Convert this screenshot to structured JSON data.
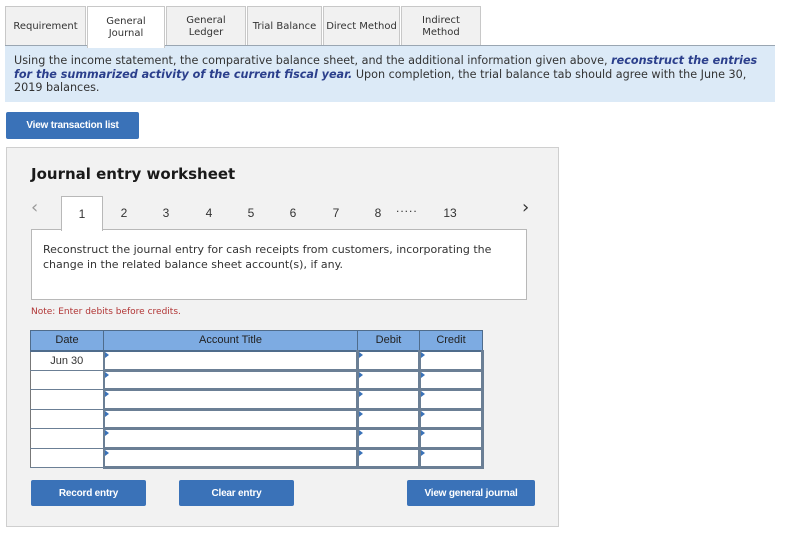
{
  "tabs": [
    {
      "label": "Requirement",
      "active": false
    },
    {
      "label": "General\nJournal",
      "active": true
    },
    {
      "label": "General\nLedger",
      "active": false
    },
    {
      "label": "Trial Balance",
      "active": false
    },
    {
      "label": "Direct Method",
      "active": false
    },
    {
      "label": "Indirect\nMethod",
      "active": false
    }
  ],
  "instructions": {
    "part1": "Using the income statement, the comparative balance sheet, and the additional information given above, ",
    "emphasis": "reconstruct the entries for the summarized activity of the current fiscal year.",
    "part2": "  Upon completion, the trial balance tab should agree with the June 30, 2019 balances."
  },
  "buttons": {
    "view_transactions": "View transaction list",
    "record_entry": "Record entry",
    "clear_entry": "Clear entry",
    "view_general_journal": "View general journal"
  },
  "worksheet": {
    "title": "Journal entry worksheet",
    "prev_icon": "‹",
    "next_icon": "›",
    "steps": [
      "1",
      "2",
      "3",
      "4",
      "5",
      "6",
      "7",
      "8",
      "13"
    ],
    "active_step": "1",
    "ellipsis": ".....",
    "prompt": "Reconstruct the journal entry for cash receipts from customers, incorporating the change in the related balance sheet account(s), if any.",
    "note": "Note: Enter debits before credits."
  },
  "journal_table": {
    "headers": {
      "date": "Date",
      "account": "Account Title",
      "debit": "Debit",
      "credit": "Credit"
    },
    "rows": [
      {
        "date": "Jun 30",
        "account": "",
        "debit": "",
        "credit": ""
      },
      {
        "date": "",
        "account": "",
        "debit": "",
        "credit": ""
      },
      {
        "date": "",
        "account": "",
        "debit": "",
        "credit": ""
      },
      {
        "date": "",
        "account": "",
        "debit": "",
        "credit": ""
      },
      {
        "date": "",
        "account": "",
        "debit": "",
        "credit": ""
      },
      {
        "date": "",
        "account": "",
        "debit": "",
        "credit": ""
      }
    ]
  },
  "colors": {
    "accent_button": "#3a72b8",
    "banner_bg": "#dceaf7",
    "table_header": "#7dabe2",
    "note_text": "#b13535",
    "emphasis_text": "#2b3f8c"
  }
}
